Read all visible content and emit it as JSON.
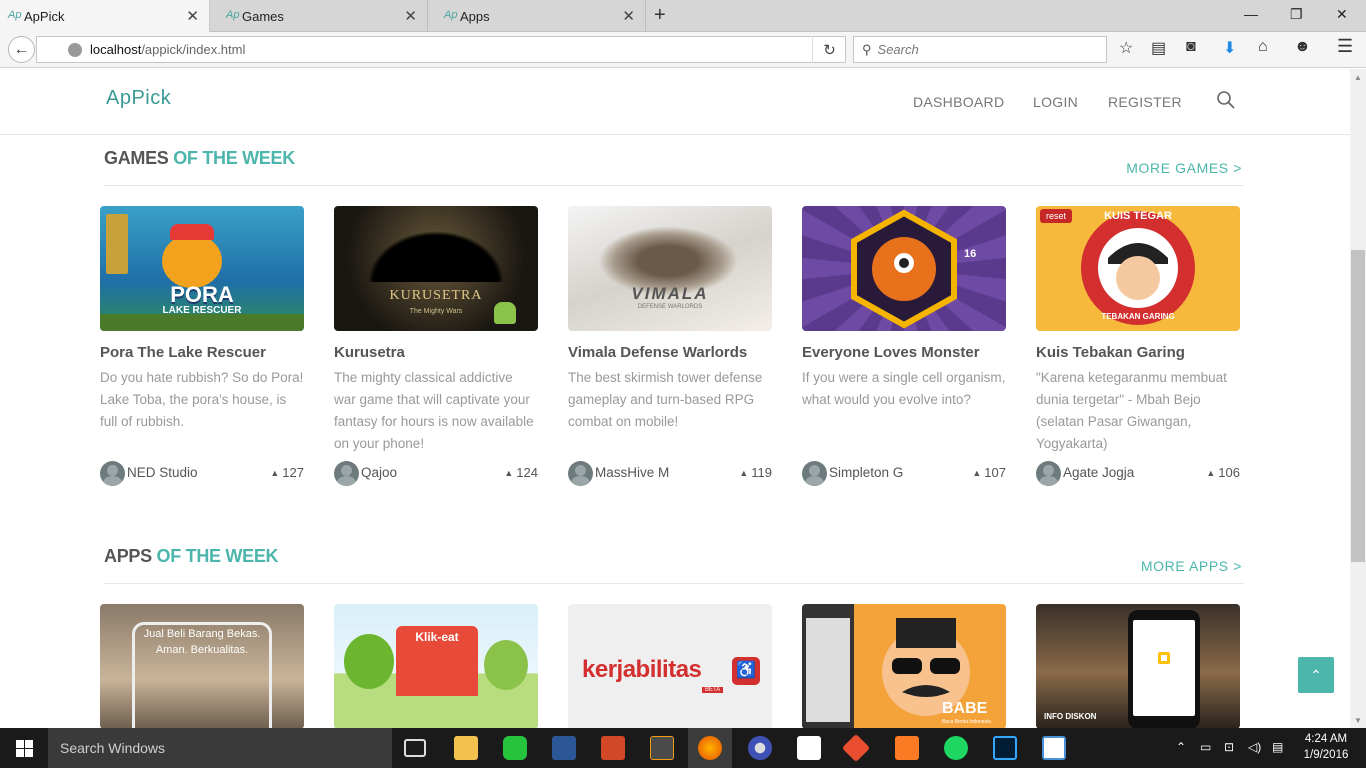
{
  "browser": {
    "tabs": [
      {
        "label": "ApPick",
        "favicon": "Ap",
        "active": true
      },
      {
        "label": "Games",
        "favicon": "Ap",
        "active": false
      },
      {
        "label": "Apps",
        "favicon": "Ap",
        "active": false
      }
    ],
    "url_host": "localhost",
    "url_path": "/appick/index.html",
    "search_placeholder": "Search"
  },
  "site": {
    "logo": "ApPick",
    "nav": [
      "DASHBOARD",
      "LOGIN",
      "REGISTER"
    ]
  },
  "games_section": {
    "title_main": "GAMES",
    "title_accent": "OF THE WEEK",
    "more_link": "MORE GAMES >",
    "cards": [
      {
        "title": "Pora The Lake Rescuer",
        "desc": "Do you hate rubbish? So do Pora! Lake Toba, the pora's house, is full of rubbish.",
        "dev": "NED Studio",
        "votes": "127",
        "thumb_text": "PORA",
        "thumb_sub": "LAKE RESCUER"
      },
      {
        "title": "Kurusetra",
        "desc": "The mighty classical addictive war game that will captivate your fantasy for hours is now available on your phone!",
        "dev": "Qajoo",
        "votes": "124",
        "thumb_text": "KURUSETRA",
        "thumb_sub": "The Mighty Wars"
      },
      {
        "title": "Vimala Defense Warlords",
        "desc": "The best skirmish tower defense gameplay and turn-based RPG combat on mobile!",
        "dev": "MassHive M",
        "votes": "119",
        "thumb_text": "VIMALA",
        "thumb_sub": "DEFENSE WARLORDS"
      },
      {
        "title": "Everyone Loves Monster",
        "desc": "If you were a single cell organism, what would you evolve into?",
        "dev": "Simpleton G",
        "votes": "107",
        "thumb_text": "16",
        "thumb_sub": ""
      },
      {
        "title": "Kuis Tebakan Garing",
        "desc": "\"Karena ketegaranmu membuat dunia tergetar\" - Mbah Bejo (selatan Pasar Giwangan, Yogyakarta)",
        "dev": "Agate Jogja",
        "votes": "106",
        "thumb_text": "KUIS TEGAR",
        "thumb_sub": "TEBAKAN GARING",
        "badge": "reset"
      }
    ]
  },
  "apps_section": {
    "title_main": "APPS",
    "title_accent": "OF THE WEEK",
    "more_link": "MORE APPS >",
    "cards": [
      {
        "thumb_text": "Jual Beli Barang Bekas. Aman. Berkualitas."
      },
      {
        "thumb_text": "Klik-eat"
      },
      {
        "thumb_text": "kerjabilitas",
        "thumb_sub": "BETA"
      },
      {
        "thumb_text": "BABE",
        "thumb_sub": "Baca Berita Indonesia"
      },
      {
        "thumb_text": "INFO DISKON"
      }
    ]
  },
  "taskbar": {
    "search_placeholder": "Search Windows",
    "time": "4:24 AM",
    "date": "1/9/2016"
  },
  "colors": {
    "accent": "#4db6ac",
    "heading": "#555555",
    "muted": "#999999"
  }
}
